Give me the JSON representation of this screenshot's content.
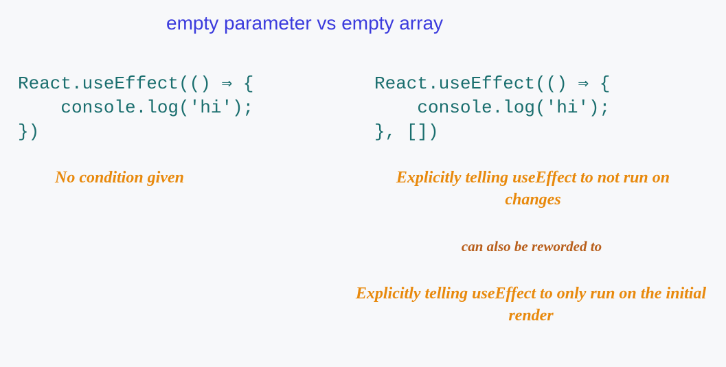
{
  "title": "empty parameter vs empty array",
  "leftCode": "React.useEffect(() ⇒ {\n    console.log('hi');\n})",
  "rightCode": "React.useEffect(() ⇒ {\n    console.log('hi');\n}, [])",
  "leftNote": "No condition given",
  "rightNote1": "Explicitly telling useEffect to not run on changes",
  "rightNote2": "can also be reworded to",
  "rightNote3": "Explicitly telling useEffect to only run on the initial render"
}
